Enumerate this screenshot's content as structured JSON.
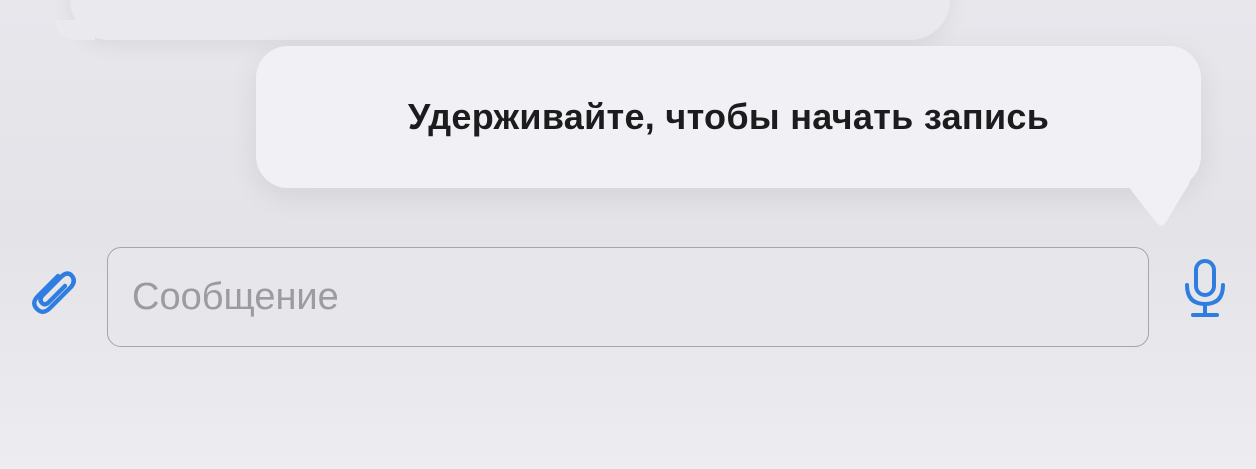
{
  "tooltip": {
    "text": "Удерживайте, чтобы начать запись"
  },
  "composer": {
    "placeholder": "Сообщение",
    "value": "",
    "attach_icon": "paperclip-icon",
    "mic_icon": "microphone-icon"
  },
  "colors": {
    "accent": "#2f7de1",
    "tooltip_bg": "#f1f0f5",
    "background": "#e5e5ea",
    "placeholder": "#9b9ba0"
  }
}
